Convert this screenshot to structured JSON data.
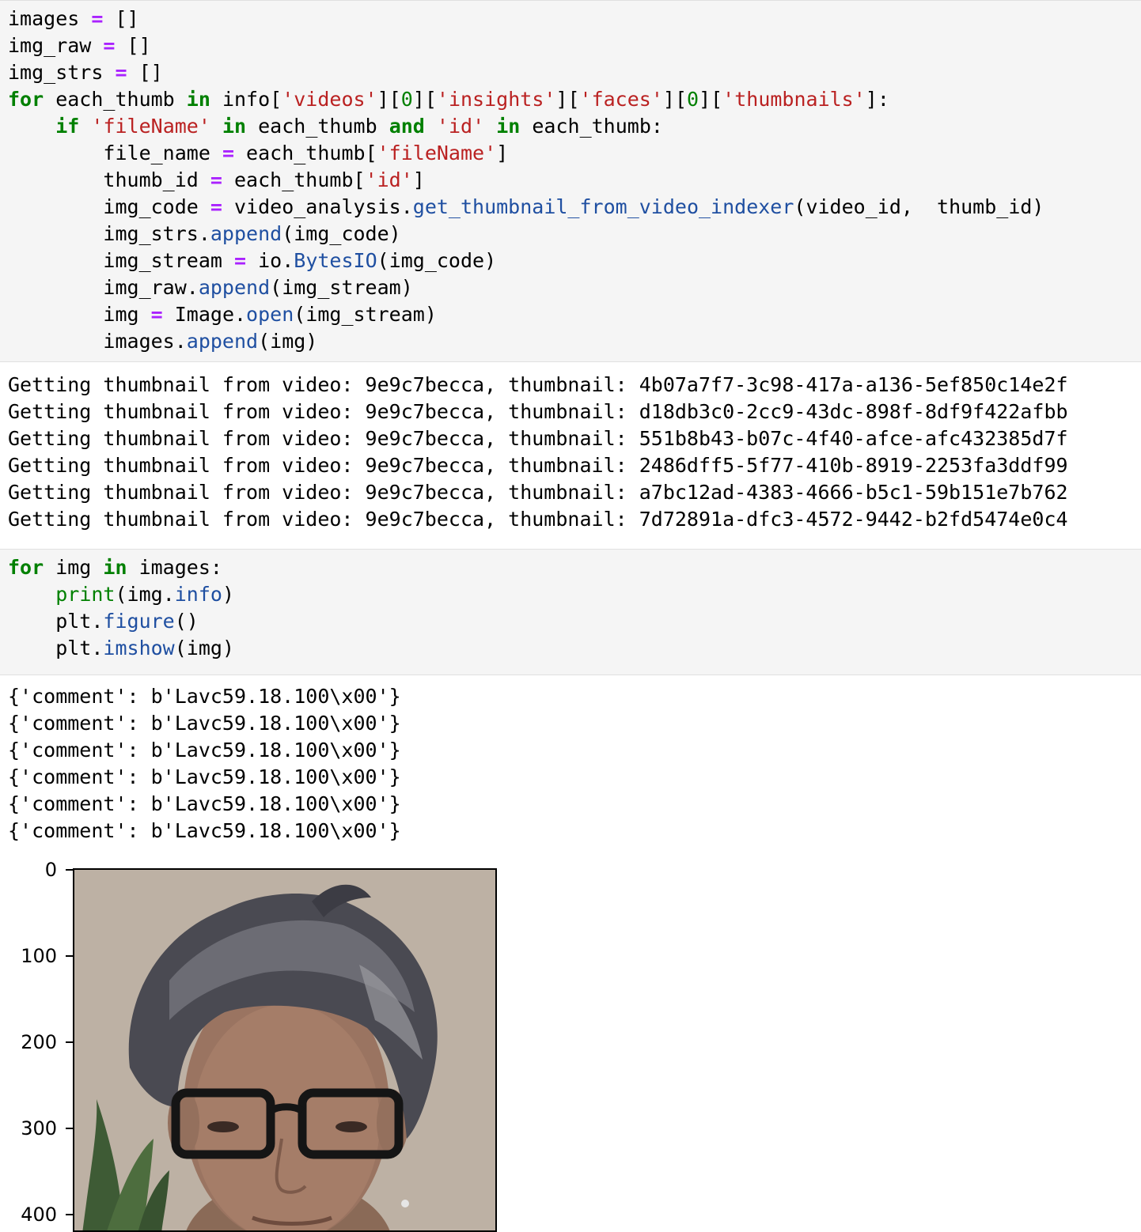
{
  "cell1": {
    "code_lines": [
      [
        [
          "",
          "images "
        ],
        [
          "op",
          "="
        ],
        [
          "",
          " []"
        ]
      ],
      [
        [
          "",
          "img_raw "
        ],
        [
          "op",
          "="
        ],
        [
          "",
          " []"
        ]
      ],
      [
        [
          "",
          "img_strs "
        ],
        [
          "op",
          "="
        ],
        [
          "",
          " []"
        ]
      ],
      [
        [
          "kw",
          "for"
        ],
        [
          "",
          " each_thumb "
        ],
        [
          "kw",
          "in"
        ],
        [
          "",
          " info["
        ],
        [
          "str",
          "'videos'"
        ],
        [
          "",
          "]["
        ],
        [
          "num",
          "0"
        ],
        [
          "",
          "]["
        ],
        [
          "str",
          "'insights'"
        ],
        [
          "",
          "]["
        ],
        [
          "str",
          "'faces'"
        ],
        [
          "",
          "]["
        ],
        [
          "num",
          "0"
        ],
        [
          "",
          "]["
        ],
        [
          "str",
          "'thumbnails'"
        ],
        [
          "",
          "]:"
        ]
      ],
      [
        [
          "",
          "    "
        ],
        [
          "kw",
          "if"
        ],
        [
          "",
          " "
        ],
        [
          "str",
          "'fileName'"
        ],
        [
          "",
          " "
        ],
        [
          "kw",
          "in"
        ],
        [
          "",
          " each_thumb "
        ],
        [
          "kw",
          "and"
        ],
        [
          "",
          " "
        ],
        [
          "str",
          "'id'"
        ],
        [
          "",
          " "
        ],
        [
          "kw",
          "in"
        ],
        [
          "",
          " each_thumb:"
        ]
      ],
      [
        [
          "",
          "        file_name "
        ],
        [
          "op",
          "="
        ],
        [
          "",
          " each_thumb["
        ],
        [
          "str",
          "'fileName'"
        ],
        [
          "",
          "]"
        ]
      ],
      [
        [
          "",
          "        thumb_id "
        ],
        [
          "op",
          "="
        ],
        [
          "",
          " each_thumb["
        ],
        [
          "str",
          "'id'"
        ],
        [
          "",
          "]"
        ]
      ],
      [
        [
          "",
          "        img_code "
        ],
        [
          "op",
          "="
        ],
        [
          "",
          " video_analysis."
        ],
        [
          "fn",
          "get_thumbnail_from_video_indexer"
        ],
        [
          "",
          "(video_id,  thumb_id)"
        ]
      ],
      [
        [
          "",
          "        img_strs."
        ],
        [
          "fn",
          "append"
        ],
        [
          "",
          "(img_code)"
        ]
      ],
      [
        [
          "",
          "        img_stream "
        ],
        [
          "op",
          "="
        ],
        [
          "",
          " io."
        ],
        [
          "fn",
          "BytesIO"
        ],
        [
          "",
          "(img_code)"
        ]
      ],
      [
        [
          "",
          "        img_raw."
        ],
        [
          "fn",
          "append"
        ],
        [
          "",
          "(img_stream)"
        ]
      ],
      [
        [
          "",
          "        img "
        ],
        [
          "op",
          "="
        ],
        [
          "",
          " Image."
        ],
        [
          "fn",
          "open"
        ],
        [
          "",
          "(img_stream)"
        ]
      ],
      [
        [
          "",
          "        images."
        ],
        [
          "fn",
          "append"
        ],
        [
          "",
          "(img)"
        ]
      ]
    ]
  },
  "output1": {
    "lines": [
      "Getting thumbnail from video: 9e9c7becca, thumbnail: 4b07a7f7-3c98-417a-a136-5ef850c14e2f",
      "Getting thumbnail from video: 9e9c7becca, thumbnail: d18db3c0-2cc9-43dc-898f-8df9f422afbb",
      "Getting thumbnail from video: 9e9c7becca, thumbnail: 551b8b43-b07c-4f40-afce-afc432385d7f",
      "Getting thumbnail from video: 9e9c7becca, thumbnail: 2486dff5-5f77-410b-8919-2253fa3ddf99",
      "Getting thumbnail from video: 9e9c7becca, thumbnail: a7bc12ad-4383-4666-b5c1-59b151e7b762",
      "Getting thumbnail from video: 9e9c7becca, thumbnail: 7d72891a-dfc3-4572-9442-b2fd5474e0c4"
    ]
  },
  "cell2": {
    "code_lines": [
      [
        [
          "kw",
          "for"
        ],
        [
          "",
          " img "
        ],
        [
          "kw",
          "in"
        ],
        [
          "",
          " images:"
        ]
      ],
      [
        [
          "",
          "    "
        ],
        [
          "bi",
          "print"
        ],
        [
          "",
          "(img."
        ],
        [
          "fn",
          "info"
        ],
        [
          "",
          ")"
        ]
      ],
      [
        [
          "",
          "    plt."
        ],
        [
          "fn",
          "figure"
        ],
        [
          "",
          "()"
        ]
      ],
      [
        [
          "",
          "    plt."
        ],
        [
          "fn",
          "imshow"
        ],
        [
          "",
          "(img)"
        ]
      ]
    ]
  },
  "output2": {
    "lines": [
      "{'comment': b'Lavc59.18.100\\x00'}",
      "{'comment': b'Lavc59.18.100\\x00'}",
      "{'comment': b'Lavc59.18.100\\x00'}",
      "{'comment': b'Lavc59.18.100\\x00'}",
      "{'comment': b'Lavc59.18.100\\x00'}",
      "{'comment': b'Lavc59.18.100\\x00'}"
    ]
  },
  "plot": {
    "y_ticks": [
      "0",
      "100",
      "200",
      "300",
      "400"
    ],
    "y_values": [
      0,
      100,
      200,
      300,
      400
    ],
    "image": "face-thumbnail-photo"
  }
}
